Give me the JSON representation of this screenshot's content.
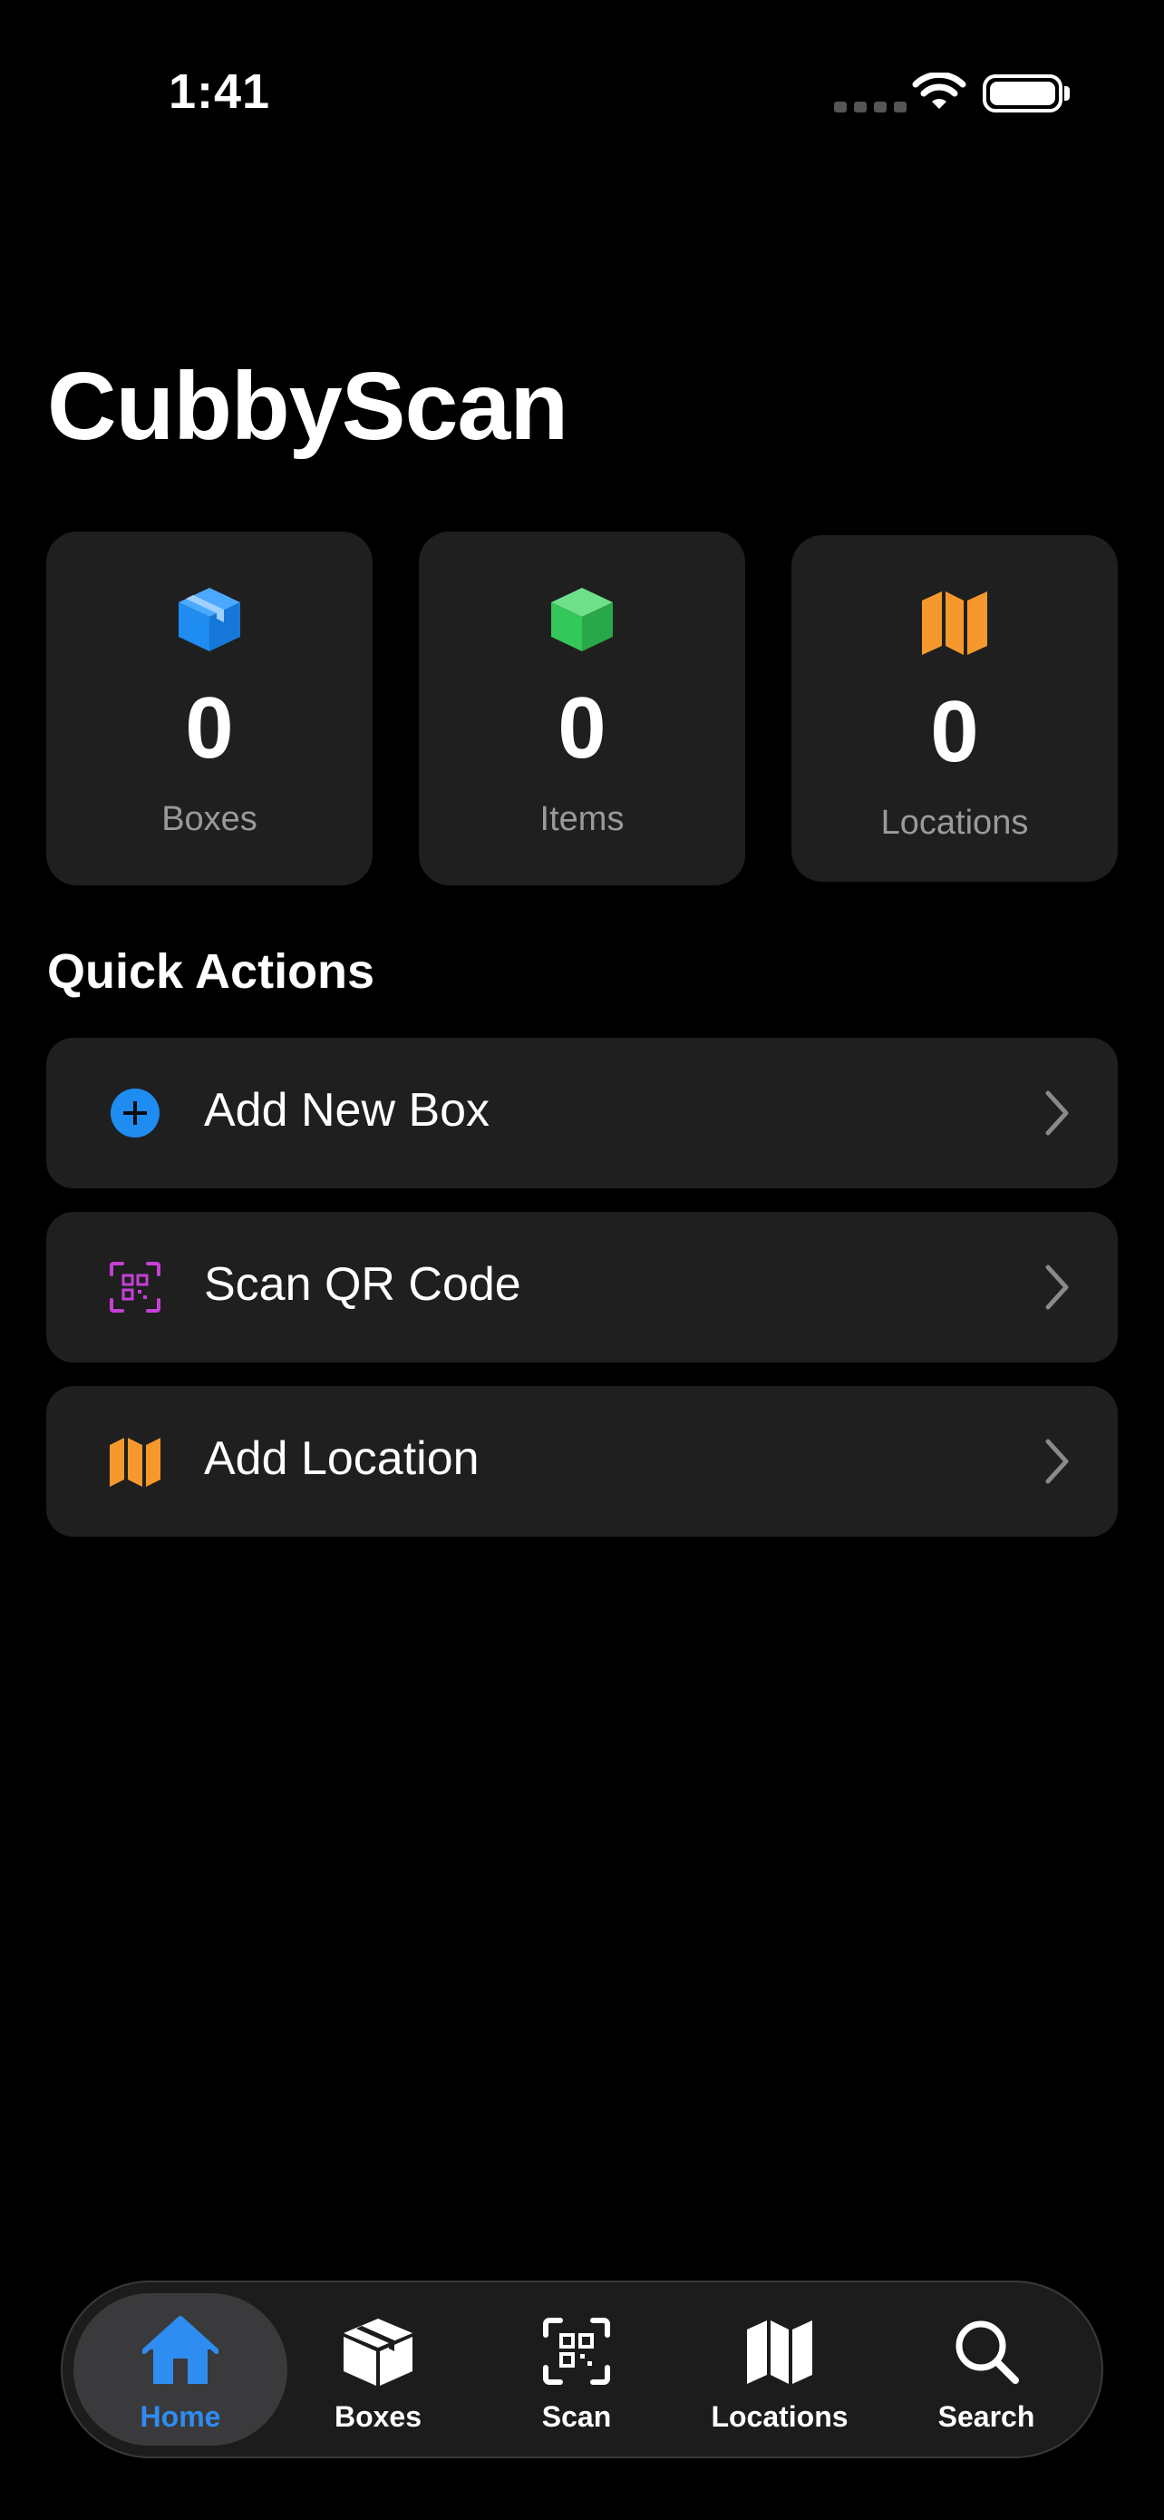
{
  "status_bar": {
    "time": "1:41"
  },
  "app": {
    "title": "CubbyScan"
  },
  "colors": {
    "boxes_accent": "#1e8cf0",
    "items_accent": "#34c759",
    "locations_accent": "#f7982d",
    "scan_accent": "#c640d6",
    "active_tab": "#2f8cf0"
  },
  "stats": [
    {
      "icon": "box-icon",
      "value": "0",
      "label": "Boxes"
    },
    {
      "icon": "cube-icon",
      "value": "0",
      "label": "Items"
    },
    {
      "icon": "map-icon",
      "value": "0",
      "label": "Locations"
    }
  ],
  "quick_actions": {
    "title": "Quick Actions",
    "items": [
      {
        "icon": "plus-circle-icon",
        "label": "Add New Box"
      },
      {
        "icon": "qr-code-icon",
        "label": "Scan QR Code"
      },
      {
        "icon": "map-icon",
        "label": "Add Location"
      }
    ]
  },
  "tab_bar": {
    "active": "Home",
    "tabs": [
      {
        "icon": "house-icon",
        "label": "Home"
      },
      {
        "icon": "box-icon",
        "label": "Boxes"
      },
      {
        "icon": "qr-scan-icon",
        "label": "Scan"
      },
      {
        "icon": "map-icon",
        "label": "Locations"
      },
      {
        "icon": "search-icon",
        "label": "Search"
      }
    ]
  }
}
